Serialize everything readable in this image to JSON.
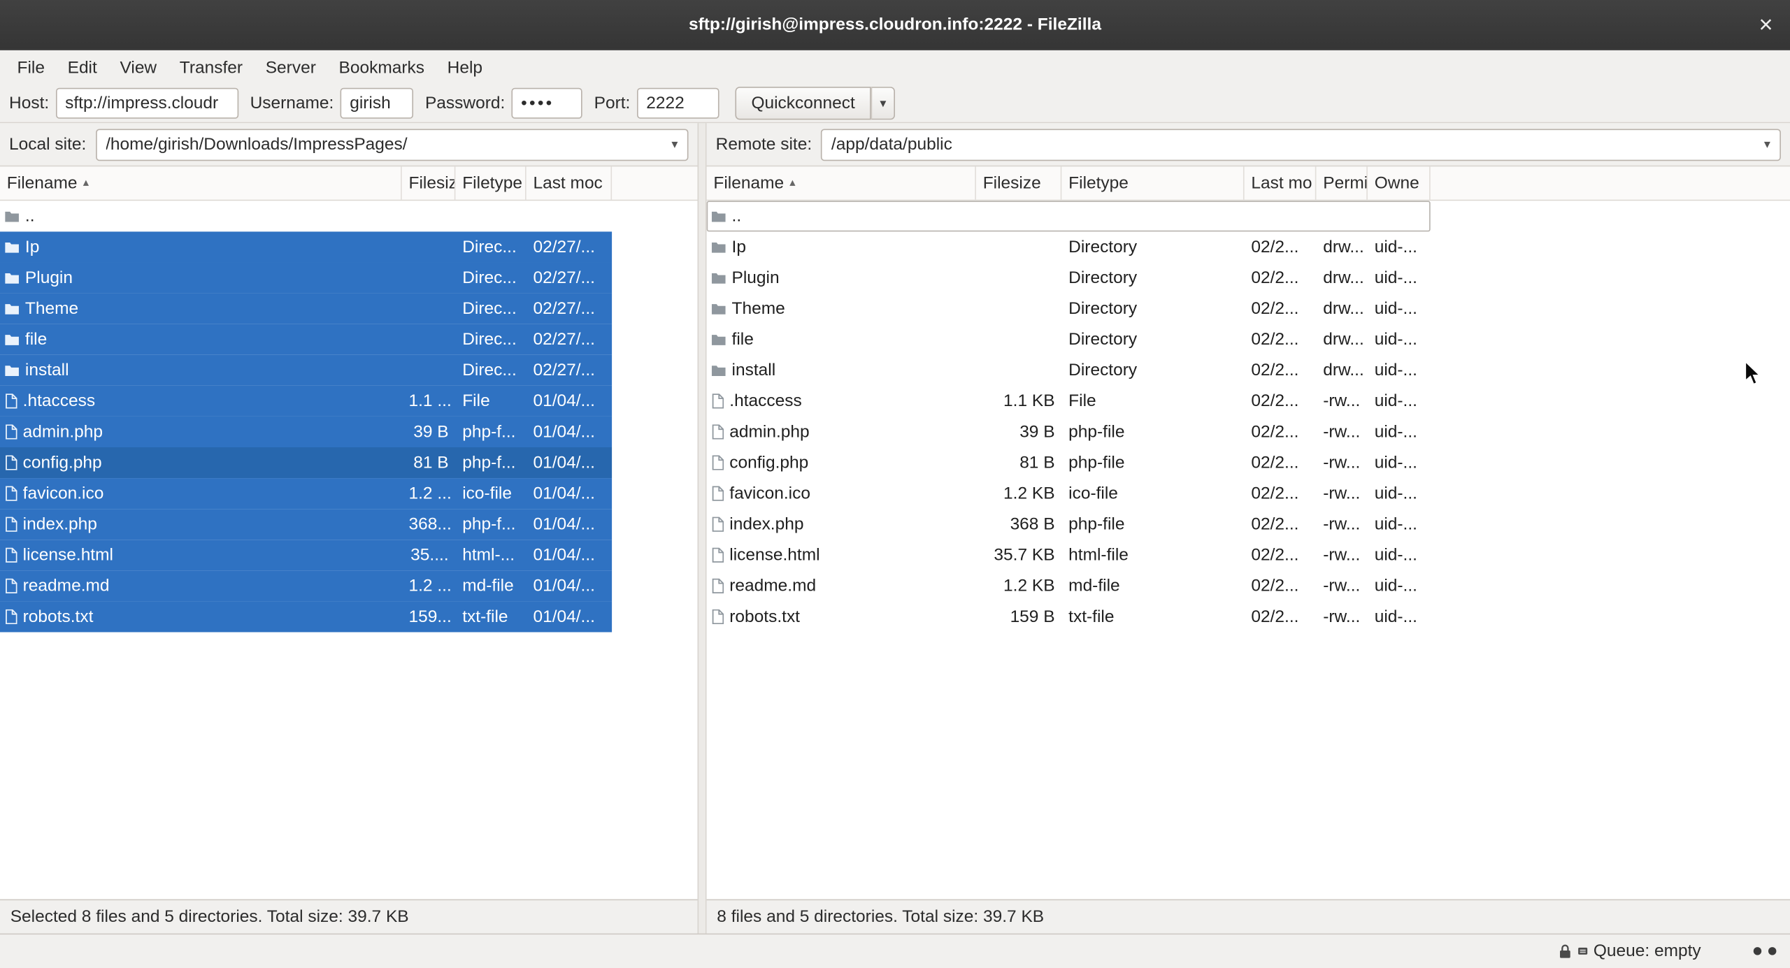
{
  "window": {
    "title": "sftp://girish@impress.cloudron.info:2222 - FileZilla",
    "close_glyph": "×"
  },
  "menu": {
    "items": [
      "File",
      "Edit",
      "View",
      "Transfer",
      "Server",
      "Bookmarks",
      "Help"
    ]
  },
  "quickconnect": {
    "host_label": "Host:",
    "host_value": "sftp://impress.cloudr",
    "username_label": "Username:",
    "username_value": "girish",
    "password_label": "Password:",
    "password_value": "••••",
    "port_label": "Port:",
    "port_value": "2222",
    "button_label": "Quickconnect"
  },
  "local": {
    "site_label": "Local site:",
    "site_value": "/home/girish/Downloads/ImpressPages/",
    "columns": [
      "Filename",
      "Filesiz",
      "Filetype",
      "Last moc"
    ],
    "rows": [
      {
        "icon": "directory",
        "name": "..",
        "size": "",
        "type": "",
        "modified": "",
        "selected": false
      },
      {
        "icon": "directory",
        "name": "Ip",
        "size": "",
        "type": "Direc...",
        "modified": "02/27/...",
        "selected": true
      },
      {
        "icon": "directory",
        "name": "Plugin",
        "size": "",
        "type": "Direc...",
        "modified": "02/27/...",
        "selected": true
      },
      {
        "icon": "directory",
        "name": "Theme",
        "size": "",
        "type": "Direc...",
        "modified": "02/27/...",
        "selected": true
      },
      {
        "icon": "directory",
        "name": "file",
        "size": "",
        "type": "Direc...",
        "modified": "02/27/...",
        "selected": true
      },
      {
        "icon": "directory",
        "name": "install",
        "size": "",
        "type": "Direc...",
        "modified": "02/27/...",
        "selected": true
      },
      {
        "icon": "file",
        "name": ".htaccess",
        "size": "1.1 ...",
        "type": "File",
        "modified": "01/04/...",
        "selected": true
      },
      {
        "icon": "file",
        "name": "admin.php",
        "size": "39 B",
        "type": "php-f...",
        "modified": "01/04/...",
        "selected": true
      },
      {
        "icon": "file",
        "name": "config.php",
        "size": "81 B",
        "type": "php-f...",
        "modified": "01/04/...",
        "selected": true,
        "focused": true
      },
      {
        "icon": "file",
        "name": "favicon.ico",
        "size": "1.2 ...",
        "type": "ico-file",
        "modified": "01/04/...",
        "selected": true
      },
      {
        "icon": "file",
        "name": "index.php",
        "size": "368...",
        "type": "php-f...",
        "modified": "01/04/...",
        "selected": true
      },
      {
        "icon": "file",
        "name": "license.html",
        "size": "35....",
        "type": "html-...",
        "modified": "01/04/...",
        "selected": true
      },
      {
        "icon": "file",
        "name": "readme.md",
        "size": "1.2 ...",
        "type": "md-file",
        "modified": "01/04/...",
        "selected": true
      },
      {
        "icon": "file",
        "name": "robots.txt",
        "size": "159...",
        "type": "txt-file",
        "modified": "01/04/...",
        "selected": true
      }
    ],
    "status": "Selected 8 files and 5 directories. Total size: 39.7 KB"
  },
  "remote": {
    "site_label": "Remote site:",
    "site_value": "/app/data/public",
    "columns": [
      "Filename",
      "Filesize",
      "Filetype",
      "Last mo",
      "Permi",
      "Owne"
    ],
    "rows": [
      {
        "icon": "directory",
        "name": "..",
        "size": "",
        "type": "",
        "modified": "",
        "perms": "",
        "owner": "",
        "frect": true
      },
      {
        "icon": "directory",
        "name": "Ip",
        "size": "",
        "type": "Directory",
        "modified": "02/2...",
        "perms": "drw...",
        "owner": "uid-..."
      },
      {
        "icon": "directory",
        "name": "Plugin",
        "size": "",
        "type": "Directory",
        "modified": "02/2...",
        "perms": "drw...",
        "owner": "uid-..."
      },
      {
        "icon": "directory",
        "name": "Theme",
        "size": "",
        "type": "Directory",
        "modified": "02/2...",
        "perms": "drw...",
        "owner": "uid-..."
      },
      {
        "icon": "directory",
        "name": "file",
        "size": "",
        "type": "Directory",
        "modified": "02/2...",
        "perms": "drw...",
        "owner": "uid-..."
      },
      {
        "icon": "directory",
        "name": "install",
        "size": "",
        "type": "Directory",
        "modified": "02/2...",
        "perms": "drw...",
        "owner": "uid-..."
      },
      {
        "icon": "file",
        "name": ".htaccess",
        "size": "1.1 KB",
        "type": "File",
        "modified": "02/2...",
        "perms": "-rw...",
        "owner": "uid-..."
      },
      {
        "icon": "file",
        "name": "admin.php",
        "size": "39 B",
        "type": "php-file",
        "modified": "02/2...",
        "perms": "-rw...",
        "owner": "uid-..."
      },
      {
        "icon": "file",
        "name": "config.php",
        "size": "81 B",
        "type": "php-file",
        "modified": "02/2...",
        "perms": "-rw...",
        "owner": "uid-..."
      },
      {
        "icon": "file",
        "name": "favicon.ico",
        "size": "1.2 KB",
        "type": "ico-file",
        "modified": "02/2...",
        "perms": "-rw...",
        "owner": "uid-..."
      },
      {
        "icon": "file",
        "name": "index.php",
        "size": "368 B",
        "type": "php-file",
        "modified": "02/2...",
        "perms": "-rw...",
        "owner": "uid-..."
      },
      {
        "icon": "file",
        "name": "license.html",
        "size": "35.7 KB",
        "type": "html-file",
        "modified": "02/2...",
        "perms": "-rw...",
        "owner": "uid-..."
      },
      {
        "icon": "file",
        "name": "readme.md",
        "size": "1.2 KB",
        "type": "md-file",
        "modified": "02/2...",
        "perms": "-rw...",
        "owner": "uid-..."
      },
      {
        "icon": "file",
        "name": "robots.txt",
        "size": "159 B",
        "type": "txt-file",
        "modified": "02/2...",
        "perms": "-rw...",
        "owner": "uid-..."
      }
    ],
    "status": "8 files and 5 directories. Total size: 39.7 KB"
  },
  "statusbar": {
    "queue_label": "Queue: empty"
  },
  "icons": {
    "close": "close-icon",
    "combo_caret": "▾",
    "dropdown_caret": "▾",
    "sort_asc": "▴",
    "directory": "folder-icon",
    "file": "file-icon",
    "lock": "lock-icon"
  }
}
